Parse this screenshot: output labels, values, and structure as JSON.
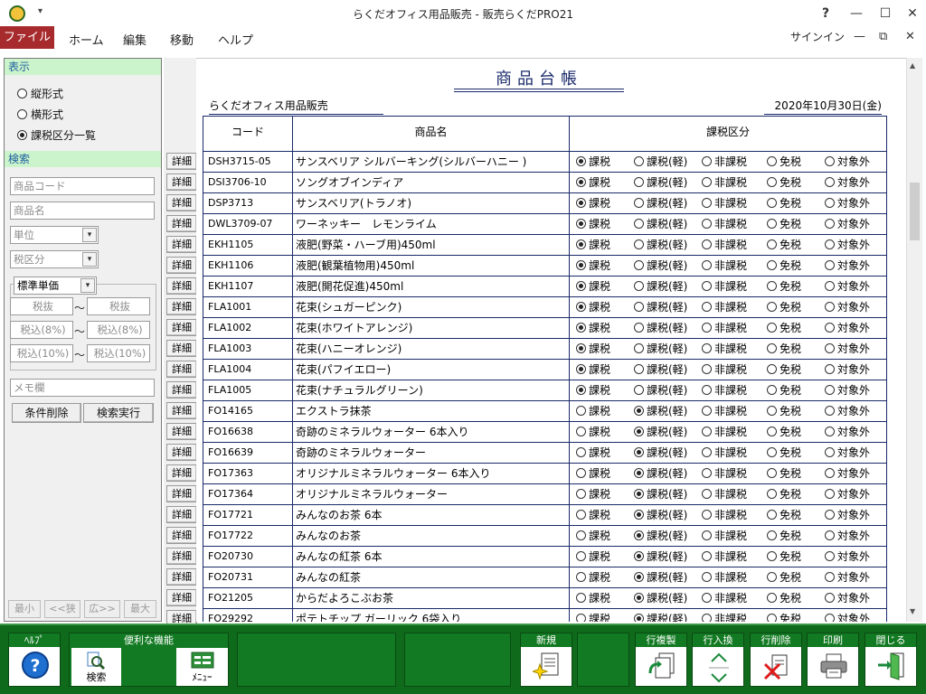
{
  "window": {
    "title": "らくだオフィス用品販売 - 販売らくだPRO21",
    "help": "?",
    "minimize": "—",
    "maximize": "☐",
    "close": "✕",
    "qa": "▾"
  },
  "menu": {
    "file": "ファイル",
    "home": "ホーム",
    "edit": "編集",
    "move": "移動",
    "help": "ヘルプ",
    "signin": "サインイン",
    "min": "—",
    "restore": "⧉",
    "close": "✕"
  },
  "left": {
    "display_head": "表示",
    "display_options": [
      "縦形式",
      "横形式",
      "課税区分一覧"
    ],
    "selected_display": 2,
    "search_head": "検索",
    "product_code_ph": "商品コード",
    "product_name_ph": "商品名",
    "unit_ph": "単位",
    "tax_type_ph": "税区分",
    "price_type": "標準単価",
    "tax_excl": "税抜",
    "tax_incl8": "税込(8%)",
    "tax_incl10": "税込(10%)",
    "tilde": "～",
    "memo_ph": "メモ欄",
    "clear_btn": "条件削除",
    "search_btn": "検索実行",
    "pager": {
      "min": "最小",
      "narrow": "<<狭",
      "wide": "広>>",
      "max": "最大"
    }
  },
  "report": {
    "title": "商品台帳",
    "company": "らくだオフィス用品販売",
    "date": "2020年10月30日(金)",
    "col_code": "コード",
    "col_name": "商品名",
    "col_tax": "課税区分",
    "detail_label": "詳細",
    "tax_labels": [
      "課税",
      "課税(軽)",
      "非課税",
      "免税",
      "対象外"
    ],
    "rows": [
      {
        "code": "DSH3715-05",
        "name": "サンスベリア シルバーキング(シルバーハニー )",
        "tax": 0
      },
      {
        "code": "DSI3706-10",
        "name": "ソングオブインディア",
        "tax": 0
      },
      {
        "code": "DSP3713",
        "name": "サンスベリア(トラノオ)",
        "tax": 0
      },
      {
        "code": "DWL3709-07",
        "name": "ワーネッキー　レモンライム",
        "tax": 0
      },
      {
        "code": "EKH1105",
        "name": "液肥(野菜・ハーブ用)450ml",
        "tax": 0
      },
      {
        "code": "EKH1106",
        "name": "液肥(観葉植物用)450ml",
        "tax": 0
      },
      {
        "code": "EKH1107",
        "name": "液肥(開花促進)450ml",
        "tax": 0
      },
      {
        "code": "FLA1001",
        "name": "花束(シュガーピンク)",
        "tax": 0
      },
      {
        "code": "FLA1002",
        "name": "花束(ホワイトアレンジ)",
        "tax": 0
      },
      {
        "code": "FLA1003",
        "name": "花束(ハニーオレンジ)",
        "tax": 0
      },
      {
        "code": "FLA1004",
        "name": "花束(パフイエロー)",
        "tax": 0
      },
      {
        "code": "FLA1005",
        "name": "花束(ナチュラルグリーン)",
        "tax": 0
      },
      {
        "code": "FO14165",
        "name": "エクストラ抹茶",
        "tax": 1
      },
      {
        "code": "FO16638",
        "name": "奇跡のミネラルウォーター 6本入り",
        "tax": 1
      },
      {
        "code": "FO16639",
        "name": "奇跡のミネラルウォーター",
        "tax": 1
      },
      {
        "code": "FO17363",
        "name": "オリジナルミネラルウォーター 6本入り",
        "tax": 1
      },
      {
        "code": "FO17364",
        "name": "オリジナルミネラルウォーター",
        "tax": 1
      },
      {
        "code": "FO17721",
        "name": "みんなのお茶 6本",
        "tax": 1
      },
      {
        "code": "FO17722",
        "name": "みんなのお茶",
        "tax": 1
      },
      {
        "code": "FO20730",
        "name": "みんなの紅茶 6本",
        "tax": 1
      },
      {
        "code": "FO20731",
        "name": "みんなの紅茶",
        "tax": 1
      },
      {
        "code": "FO21205",
        "name": "からだよろこぶお茶",
        "tax": 1
      },
      {
        "code": "FO29292",
        "name": "ポテトチップ ガーリック 6袋入り",
        "tax": 1
      }
    ]
  },
  "fkeys": {
    "help": "ﾍﾙﾌﾟ",
    "tools": "便利な機能",
    "search": "検索",
    "menu": "ﾒﾆｭｰ",
    "new": "新規",
    "copy_row": "行複製",
    "swap_row": "行入換",
    "delete_row": "行削除",
    "print": "印刷",
    "close": "閉じる"
  }
}
